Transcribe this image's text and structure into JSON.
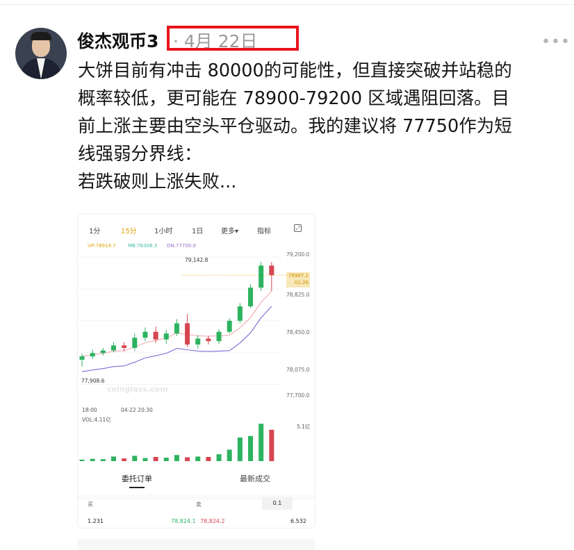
{
  "post": {
    "username": "俊杰观币3",
    "date": "· 4月 22日",
    "more": "•••",
    "lines": [
      "大饼目前有冲击 80000的可能性，但直接突破并站稳的",
      "概率较低，更可能在 78900-79200 区域遇阻回落。目",
      "前上涨主要由空头平仓驱动。我的建议将 77750作为短",
      "线强弱分界线：",
      "若跌破则上涨失败..."
    ]
  },
  "card": {
    "tabs": [
      "1分",
      "15分",
      "1小时",
      "1日",
      "更多▾",
      "指标"
    ],
    "active_tab": "15分",
    "indicators": {
      "up": "UP:78914.7",
      "mb": "MB:78308.3",
      "dn": "DN:77700.0"
    },
    "y_labels": [
      "79,200.0",
      "78,825.0",
      "78,450.0",
      "78,075.0",
      "77,700.0"
    ],
    "price_tag": {
      "price": "78987.2",
      "countdown": "01:26"
    },
    "high_label": "79,142.8",
    "low_label": "77,908.6",
    "x_labels": [
      "18:00",
      "04-22 20:30"
    ],
    "volume_label": "VOL:4.11亿",
    "volume_max": "5.1亿",
    "watermark": "coinglass.com",
    "order_tabs": [
      "委托订单",
      "最新成交"
    ],
    "orderbook": {
      "buy_label": "买",
      "sell_label": "卖",
      "depth": "0.1",
      "bid_qty": "1.231",
      "bid_price": "78,824.1",
      "ask_price": "78,824.2",
      "ask_qty": "6.532"
    },
    "colors": {
      "up": "#2db360",
      "down": "#d64550",
      "accent": "#e0a300"
    }
  },
  "chart_data": {
    "type": "candlestick",
    "ylim": [
      77500,
      79300
    ],
    "candles": [
      {
        "o": 77990,
        "c": 78030,
        "h": 78060,
        "l": 77909
      },
      {
        "o": 78030,
        "c": 78070,
        "h": 78110,
        "l": 78000
      },
      {
        "o": 78070,
        "c": 78100,
        "h": 78130,
        "l": 78040
      },
      {
        "o": 78100,
        "c": 78160,
        "h": 78200,
        "l": 78080
      },
      {
        "o": 78160,
        "c": 78130,
        "h": 78200,
        "l": 78090
      },
      {
        "o": 78130,
        "c": 78250,
        "h": 78300,
        "l": 78100
      },
      {
        "o": 78250,
        "c": 78320,
        "h": 78370,
        "l": 78210
      },
      {
        "o": 78320,
        "c": 78230,
        "h": 78380,
        "l": 78190
      },
      {
        "o": 78230,
        "c": 78300,
        "h": 78340,
        "l": 78180
      },
      {
        "o": 78300,
        "c": 78420,
        "h": 78470,
        "l": 78270
      },
      {
        "o": 78420,
        "c": 78170,
        "h": 78530,
        "l": 78140
      },
      {
        "o": 78170,
        "c": 78240,
        "h": 78280,
        "l": 78120
      },
      {
        "o": 78240,
        "c": 78210,
        "h": 78270,
        "l": 78170
      },
      {
        "o": 78210,
        "c": 78320,
        "h": 78350,
        "l": 78180
      },
      {
        "o": 78320,
        "c": 78450,
        "h": 78480,
        "l": 78300
      },
      {
        "o": 78450,
        "c": 78620,
        "h": 78660,
        "l": 78420
      },
      {
        "o": 78620,
        "c": 78840,
        "h": 78880,
        "l": 78600
      },
      {
        "o": 78840,
        "c": 79100,
        "h": 79143,
        "l": 78800
      },
      {
        "o": 79100,
        "c": 78987,
        "h": 79143,
        "l": 78800
      }
    ],
    "volumes": [
      0.2,
      0.3,
      0.25,
      0.6,
      0.35,
      0.7,
      0.4,
      0.55,
      0.45,
      0.8,
      0.5,
      0.6,
      0.55,
      0.9,
      1.5,
      3.1,
      3.3,
      4.9,
      4.11
    ],
    "vol_max": 5.1
  }
}
